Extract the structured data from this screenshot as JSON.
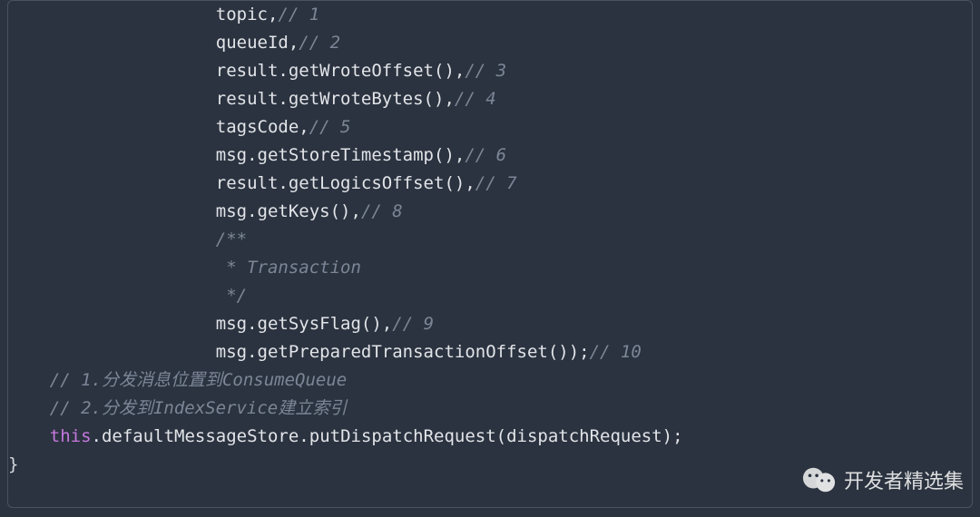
{
  "code": {
    "indent0": "",
    "indent1": "    ",
    "indent2": "                    ",
    "l1a": "topic,",
    "l1c": "// 1",
    "l2a": "queueId,",
    "l2c": "// 2",
    "l3a": "result.getWroteOffset(),",
    "l3c": "// 3",
    "l4a": "result.getWroteBytes(),",
    "l4c": "// 4",
    "l5a": "tagsCode,",
    "l5c": "// 5",
    "l6a": "msg.getStoreTimestamp(),",
    "l6c": "// 6",
    "l7a": "result.getLogicsOffset(),",
    "l7c": "// 7",
    "l8a": "msg.getKeys(),",
    "l8c": "// 8",
    "l9a": "/**",
    "l10a": " * Transaction",
    "l11a": " */",
    "l12a": "msg.getSysFlag(),",
    "l12c": "// 9",
    "l13a": "msg.getPreparedTransactionOffset());",
    "l13c": "// 10",
    "l14c": "// 1.分发消息位置到ConsumeQueue",
    "l15c": "// 2.分发到IndexService建立索引",
    "l16_kw": "this",
    "l16_rest": ".defaultMessageStore.putDispatchRequest(dispatchRequest);",
    "l17": "}"
  },
  "watermark": {
    "text": "开发者精选集"
  }
}
